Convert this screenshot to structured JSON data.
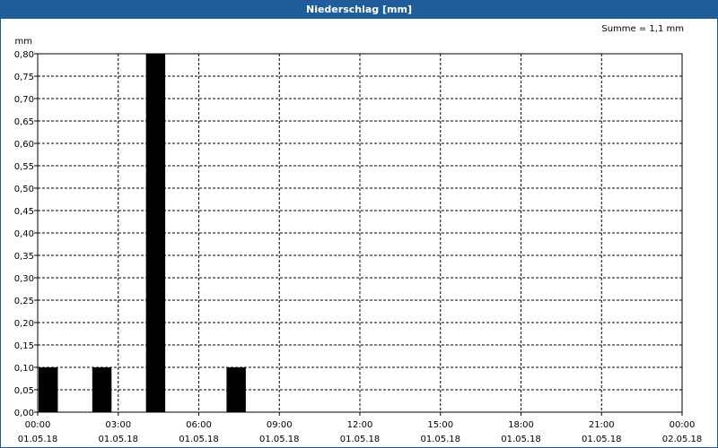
{
  "title": "Niederschlag [mm]",
  "summary": "Summe = 1,1 mm",
  "colors": {
    "titlebar": "#1f5e9b",
    "bar": "#000000",
    "grid": "#000000"
  },
  "chart_data": {
    "type": "bar",
    "title": "Niederschlag [mm]",
    "ylabel": "mm",
    "ylim": [
      0,
      0.8
    ],
    "yticks": [
      "0,00",
      "0,05",
      "0,10",
      "0,15",
      "0,20",
      "0,25",
      "0,30",
      "0,35",
      "0,40",
      "0,45",
      "0,50",
      "0,55",
      "0,60",
      "0,65",
      "0,70",
      "0,75",
      "0,80"
    ],
    "xlim": [
      "01.05.18 00:00",
      "02.05.18 00:00"
    ],
    "xticks": [
      {
        "time": "00:00",
        "date": "01.05.18"
      },
      {
        "time": "03:00",
        "date": "01.05.18"
      },
      {
        "time": "06:00",
        "date": "01.05.18"
      },
      {
        "time": "09:00",
        "date": "01.05.18"
      },
      {
        "time": "12:00",
        "date": "01.05.18"
      },
      {
        "time": "15:00",
        "date": "01.05.18"
      },
      {
        "time": "18:00",
        "date": "01.05.18"
      },
      {
        "time": "21:00",
        "date": "01.05.18"
      },
      {
        "time": "00:00",
        "date": "02.05.18"
      }
    ],
    "bars": [
      {
        "start": "01.05.18 00:00",
        "end": "01.05.18 00:45",
        "value": 0.1
      },
      {
        "start": "01.05.18 02:00",
        "end": "01.05.18 02:45",
        "value": 0.1
      },
      {
        "start": "01.05.18 04:00",
        "end": "01.05.18 04:45",
        "value": 0.8
      },
      {
        "start": "01.05.18 07:00",
        "end": "01.05.18 07:45",
        "value": 0.1
      }
    ],
    "grid": true
  }
}
